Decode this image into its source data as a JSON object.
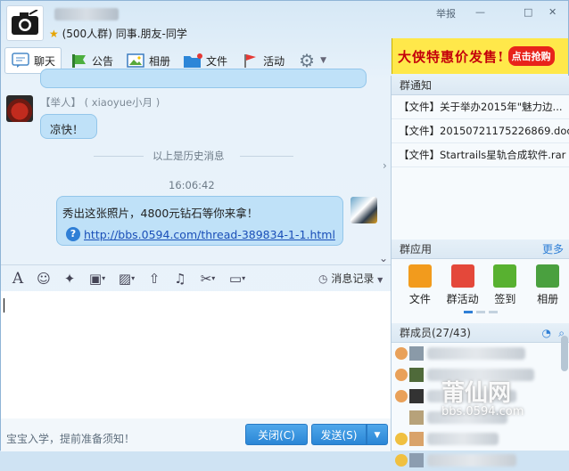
{
  "header": {
    "member_count": "(500人群)",
    "group_tags": "同事.朋友-同学",
    "controls": [
      "举报",
      "—",
      "□",
      "✕"
    ]
  },
  "tabs": [
    {
      "label": "聊天",
      "icon": "chat-icon"
    },
    {
      "label": "公告",
      "icon": "announcement-icon"
    },
    {
      "label": "相册",
      "icon": "album-icon"
    },
    {
      "label": "文件",
      "icon": "folder-icon"
    },
    {
      "label": "活动",
      "icon": "flag-icon"
    }
  ],
  "ad": {
    "text": "大侠特惠价发售!",
    "button": "点击抢购"
  },
  "chat": {
    "msg1": {
      "sender_title": "【举人】",
      "sender_name": "( xiaoyue小月 )",
      "text": "凉快！"
    },
    "history_divider": "以上是历史消息",
    "timestamp": "16:06:42",
    "msg2": {
      "text": "秀出这张照片，4800元钻石等你来拿！",
      "link": "http://bbs.0594.com/thread-389834-1-1.html"
    }
  },
  "toolbar": {
    "history_label": "消息记录"
  },
  "bottom": {
    "tip": "宝宝入学，提前准备须知！",
    "close_label": "关闭(C)",
    "send_label": "发送(S)"
  },
  "notice": {
    "title": "群通知",
    "items": [
      "【文件】关于举办2015年\"魅力边...",
      "【文件】20150721175226869.doc",
      "【文件】Startrails星轨合成软件.rar"
    ]
  },
  "apps": {
    "title": "群应用",
    "more": "更多",
    "items": [
      {
        "label": "文件",
        "color": "#f29b1d"
      },
      {
        "label": "群活动",
        "color": "#e4483a"
      },
      {
        "label": "签到",
        "color": "#58b130"
      },
      {
        "label": "相册",
        "color": "#4aa03f"
      }
    ]
  },
  "members": {
    "title": "群成员(27/43)"
  },
  "watermark": {
    "brand": "莆仙网",
    "url": "bbs.0594.com"
  }
}
